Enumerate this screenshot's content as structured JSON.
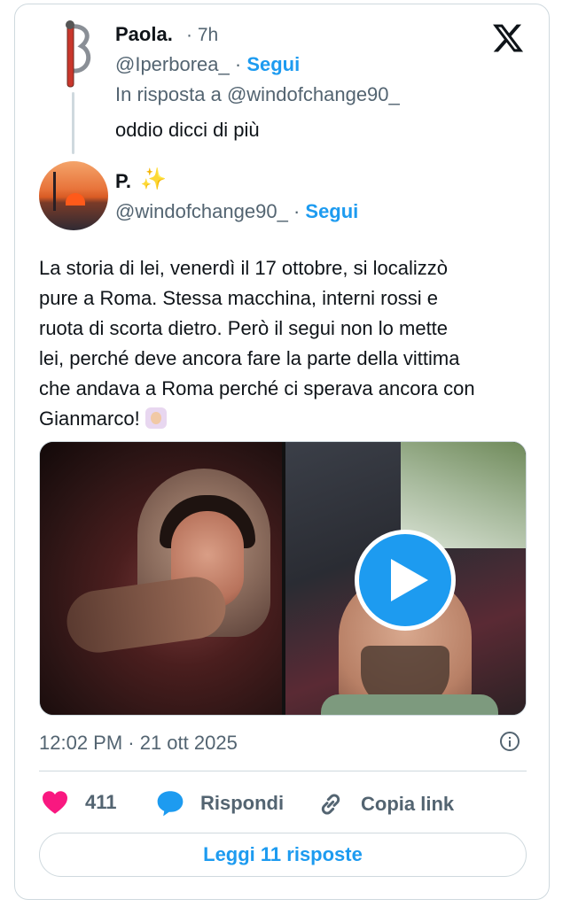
{
  "reply_tweet": {
    "name": "Paola.",
    "time": "· 7h",
    "handle": "@Iperborea_",
    "follow_label": "Segui",
    "reply_to": "In risposta a @windofchange90_",
    "text": "oddio dicci di più"
  },
  "main_tweet": {
    "name": "P.",
    "name_emoji": "✨",
    "handle": "@windofchange90_",
    "follow_label": "Segui",
    "text": "La storia di lei, venerdì il 17 ottobre, si localizzò\npure a Roma. Stessa macchina, interni rossi e\nruota di scorta dietro. Però il segui non lo mette\nlei, perché deve ancora fare la parte della vittima\nche andava a Roma perché ci sperava ancora con\nGianmarco! ",
    "timestamp": "12:02 PM · 21 ott 2025"
  },
  "actions": {
    "likes": "411",
    "reply_label": "Rispondi",
    "copy_label": "Copia link"
  },
  "read_replies_label": "Leggi 11 risposte",
  "colors": {
    "accent": "#1d9bf0",
    "like": "#f91880",
    "muted": "#536471"
  },
  "icons": [
    "x-logo-icon",
    "heart-icon",
    "reply-bubble-icon",
    "link-icon",
    "info-icon",
    "play-icon"
  ]
}
